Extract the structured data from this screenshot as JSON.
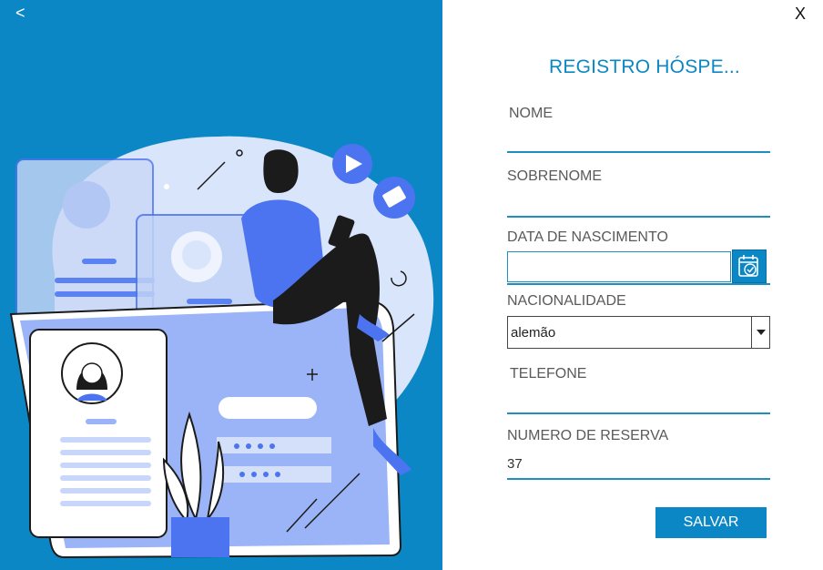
{
  "nav": {
    "back_label": "<",
    "close_label": "X"
  },
  "form": {
    "title": "REGISTRO HÓSPE...",
    "fields": {
      "nome_label": "NOME",
      "sobrenome_label": "SOBRENOME",
      "data_nascimento_label": "DATA DE NASCIMENTO",
      "nacionalidade_label": "NACIONALIDADE",
      "nacionalidade_value": "alemão",
      "telefone_label": "TELEFONE",
      "numero_reserva_label": "NUMERO DE RESERVA",
      "numero_reserva_value": "37"
    },
    "save_label": "SALVAR"
  },
  "icons": {
    "calendar": "calendar-check-icon",
    "dropdown": "chevron-down-icon"
  },
  "colors": {
    "brand_blue": "#0b87c6",
    "underline": "#1f8fc2",
    "illustration_accent": "#4d74f0"
  }
}
